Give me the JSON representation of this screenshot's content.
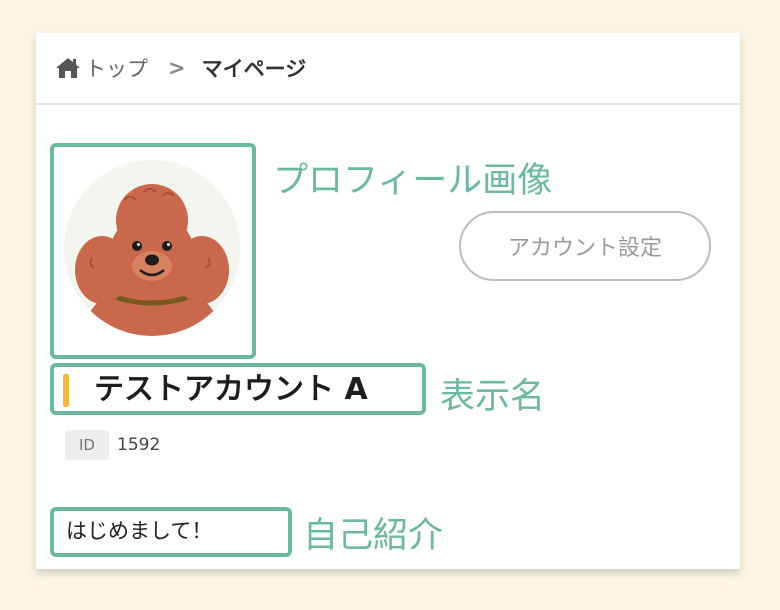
{
  "breadcrumb": {
    "home_icon": "home-icon",
    "home_label": "トップ",
    "separator": ">",
    "current": "マイページ"
  },
  "profile": {
    "avatar_alt_icon": "poodle-avatar",
    "account_settings_label": "アカウント設定",
    "display_name": "テストアカウント A",
    "id_label": "ID",
    "id_value": "1592",
    "bio": "はじめまして！"
  },
  "annotations": {
    "avatar_callout": "プロフィール画像",
    "name_callout": "表示名",
    "bio_callout": "自己紹介"
  },
  "colors": {
    "background": "#fdf6e6",
    "highlight": "#6cb9a2",
    "name_accent": "#f0b93b"
  }
}
